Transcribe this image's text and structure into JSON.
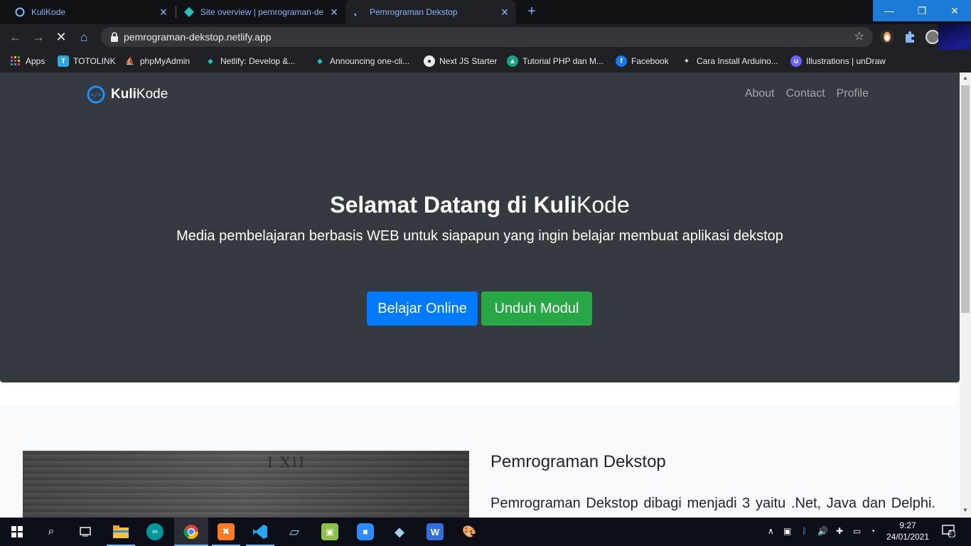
{
  "browser": {
    "tabs": [
      {
        "title": "KuliKode",
        "active": false
      },
      {
        "title": "Site overview | pemrograman-de",
        "active": false
      },
      {
        "title": "Pemrograman Dekstop",
        "active": true
      }
    ],
    "url": "pemrograman-dekstop.netlify.app",
    "bookmarks": [
      {
        "label": "Apps",
        "icon": "apps-grid-icon",
        "color": "#ea4335"
      },
      {
        "label": "TOTOLINK",
        "icon": "totolink-icon",
        "color": "#2aa8e0"
      },
      {
        "label": "phpMyAdmin",
        "icon": "phpmyadmin-icon",
        "color": "#f89c0e"
      },
      {
        "label": "Netlify: Develop &...",
        "icon": "netlify-icon",
        "color": "#20c6b7"
      },
      {
        "label": "Announcing one-cli...",
        "icon": "netlify-icon",
        "color": "#20c6b7"
      },
      {
        "label": "Next JS Starter",
        "icon": "github-icon",
        "color": "#e8eaed"
      },
      {
        "label": "Tutorial PHP dan M...",
        "icon": "edu-icon",
        "color": "#15a388"
      },
      {
        "label": "Facebook",
        "icon": "facebook-icon",
        "color": "#1877f2"
      },
      {
        "label": "Cara Install Arduino...",
        "icon": "site-icon",
        "color": "#222"
      },
      {
        "label": "Illustrations | unDraw",
        "icon": "undraw-icon",
        "color": "#6c63ff"
      }
    ]
  },
  "site": {
    "brand_bold": "Kuli",
    "brand_rest": "Kode",
    "nav": [
      "About",
      "Contact",
      "Profile"
    ],
    "hero_title_prefix": "Selamat Datang di ",
    "hero_title_bold": "Kuli",
    "hero_title_rest": "Kode",
    "hero_subtitle": "Media pembelajaran berbasis WEB untuk siapapun yang ingin belajar membuat aplikasi dekstop",
    "btn_primary": "Belajar Online",
    "btn_success": "Unduh Modul",
    "section_title": "Pemrograman Dekstop",
    "section_text": "Pemrograman Dekstop dibagi menjadi 3 yaitu .Net, Java dan Delphi.",
    "photo_text": "I XII"
  },
  "taskbar": {
    "time": "9:27",
    "date": "24/01/2021",
    "notifications": "2"
  },
  "colors": {
    "hero_bg": "#343a40",
    "primary": "#007bff",
    "success": "#28a745",
    "section_bg": "#f8f9fa"
  }
}
